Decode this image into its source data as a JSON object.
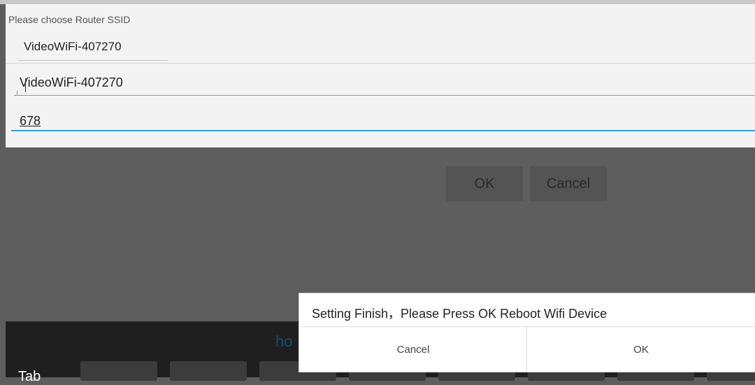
{
  "form": {
    "router_label": "Please choose Router SSID",
    "ssid_selected": "VideoWiFi-407270",
    "ssid_value": "VideoWiFi-407270",
    "password_value": "678"
  },
  "background_buttons": {
    "ok": "OK",
    "cancel": "Cancel"
  },
  "keyboard": {
    "suggestion": "ho",
    "tab_label": "Tab"
  },
  "dialog": {
    "message": "Setting Finish，Please Press OK Reboot Wifi Device",
    "cancel": "Cancel",
    "ok": "OK"
  }
}
